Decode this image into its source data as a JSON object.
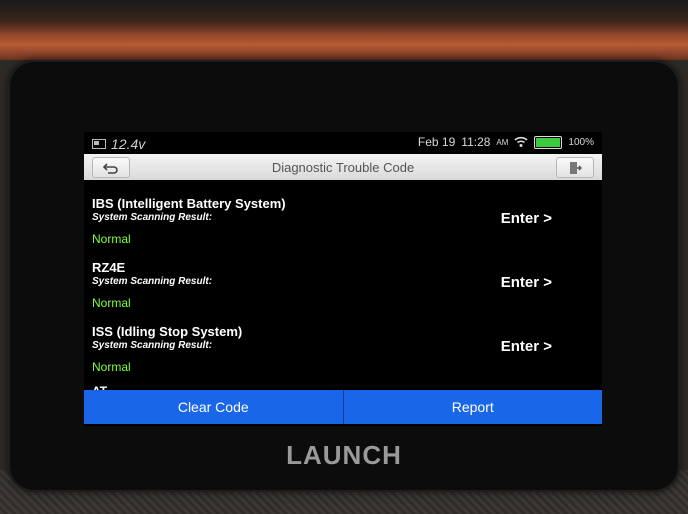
{
  "device": {
    "brand": "LAUNCH"
  },
  "status": {
    "voltage": "12.4v",
    "date": "Feb 19",
    "time": "11:28",
    "ampm": "AM",
    "battery_pct": "100%"
  },
  "titlebar": {
    "title": "Diagnostic Trouble Code"
  },
  "systems": [
    {
      "name": "IBS (Intelligent Battery System)",
      "sub": "System Scanning Result:",
      "status": "Normal",
      "action": "Enter >"
    },
    {
      "name": "RZ4E",
      "sub": "System Scanning Result:",
      "status": "Normal",
      "action": "Enter >"
    },
    {
      "name": "ISS (Idling Stop System)",
      "sub": "System Scanning Result:",
      "status": "Normal",
      "action": "Enter >"
    }
  ],
  "partial_item": "AT",
  "buttons": {
    "clear": "Clear Code",
    "report": "Report"
  },
  "colors": {
    "accent": "#1967e8",
    "normal": "#7cff3f",
    "battery": "#3ccb3c"
  }
}
